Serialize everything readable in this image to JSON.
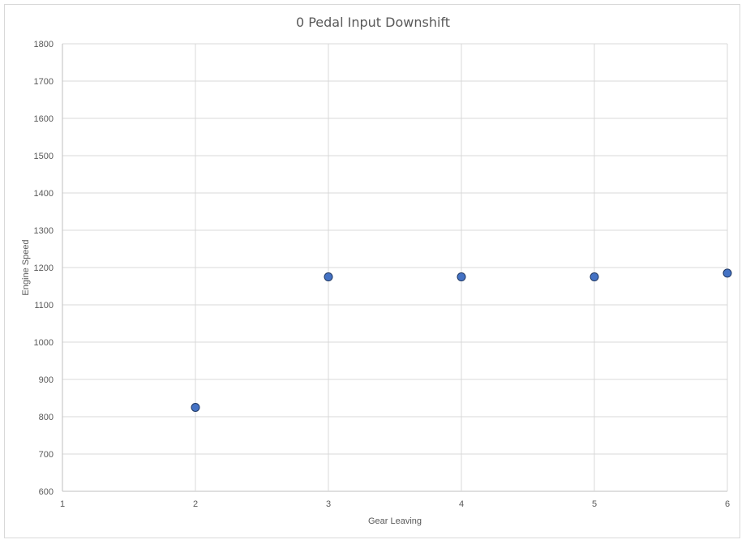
{
  "chart_data": {
    "type": "scatter",
    "title": "0 Pedal Input Downshift",
    "xlabel": "Gear Leaving",
    "ylabel": "Engine Speed",
    "xlim": [
      1,
      6
    ],
    "ylim": [
      600,
      1800
    ],
    "xticks": [
      1,
      2,
      3,
      4,
      5,
      6
    ],
    "yticks": [
      600,
      700,
      800,
      900,
      1000,
      1100,
      1200,
      1300,
      1400,
      1500,
      1600,
      1700,
      1800
    ],
    "grid": true,
    "legend": "none",
    "series": [
      {
        "color": "#4472c4",
        "points": [
          {
            "x": 2,
            "y": 825
          },
          {
            "x": 3,
            "y": 1175
          },
          {
            "x": 4,
            "y": 1175
          },
          {
            "x": 5,
            "y": 1175
          },
          {
            "x": 6,
            "y": 1185
          }
        ]
      }
    ]
  }
}
